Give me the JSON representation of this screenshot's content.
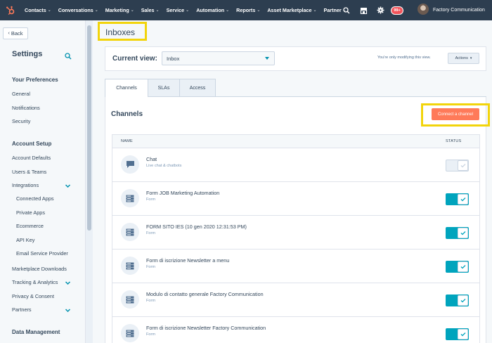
{
  "topnav": {
    "items": [
      {
        "label": "Contacts"
      },
      {
        "label": "Conversations"
      },
      {
        "label": "Marketing"
      },
      {
        "label": "Sales"
      },
      {
        "label": "Service"
      },
      {
        "label": "Automation"
      },
      {
        "label": "Reports"
      },
      {
        "label": "Asset Marketplace"
      },
      {
        "label": "Partner"
      }
    ],
    "notification_count": "99+",
    "account_name": "Factory Communication",
    "colors": {
      "bar": "#2d3e50",
      "logo": "#ff7a59",
      "badge": "#f2545b"
    }
  },
  "sidebar": {
    "back_label": "Back",
    "title": "Settings",
    "sections": [
      {
        "title": "Your Preferences",
        "items": [
          "General",
          "Notifications",
          "Security"
        ]
      },
      {
        "title": "Account Setup",
        "items": [
          "Account Defaults",
          "Users & Teams",
          "Integrations",
          "Connected Apps",
          "Private Apps",
          "Ecommerce",
          "API Key",
          "Email Service Provider",
          "Marketplace Downloads",
          "Tracking & Analytics",
          "Privacy & Consent",
          "Partners"
        ]
      },
      {
        "title": "Data Management",
        "items": []
      }
    ]
  },
  "page": {
    "title": "Inboxes",
    "current_view_label": "Current view:",
    "current_view_value": "Inbox",
    "modify_note": "You're only modifying this view.",
    "actions_label": "Actions"
  },
  "tabs": [
    {
      "label": "Channels",
      "active": true
    },
    {
      "label": "SLAs",
      "active": false
    },
    {
      "label": "Access",
      "active": false
    }
  ],
  "channels": {
    "title": "Channels",
    "connect_label": "Connect a channel",
    "columns": {
      "name": "NAME",
      "status": "STATUS"
    },
    "rows": [
      {
        "name": "Chat",
        "type": "Live chat & chatbots",
        "icon": "chat-bubble-icon",
        "enabled": false
      },
      {
        "name": "Form JOB Marketing Automation",
        "type": "Form",
        "icon": "form-icon",
        "enabled": true
      },
      {
        "name": "FORM SITO IES (10 gen 2020 12:31:53 PM)",
        "type": "Form",
        "icon": "form-icon",
        "enabled": true
      },
      {
        "name": "Form di iscrizione Newsletter a menu",
        "type": "Form",
        "icon": "form-icon",
        "enabled": true
      },
      {
        "name": "Modulo di contatto generale Factory Communication",
        "type": "Form",
        "icon": "form-icon",
        "enabled": true
      },
      {
        "name": "Form di iscrizione Newsletter Factory Communication",
        "type": "Form",
        "icon": "form-icon",
        "enabled": true
      }
    ]
  },
  "colors": {
    "accent": "#ff7a59",
    "toggle_on": "#00a4bd",
    "highlight": "#f2d40b",
    "link": "#0091ae"
  }
}
